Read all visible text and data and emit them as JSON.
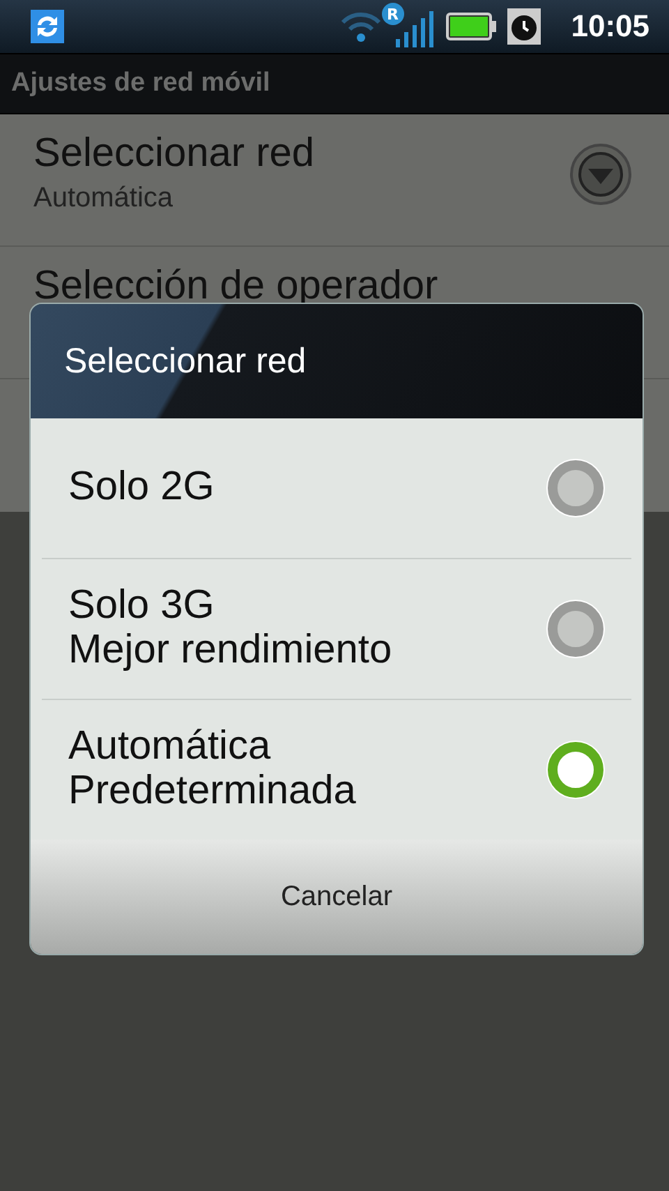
{
  "status_bar": {
    "time": "10:05",
    "roaming": "R"
  },
  "title_bar": {
    "title": "Ajustes de red móvil"
  },
  "settings": [
    {
      "title": "Seleccionar red",
      "summary": "Automática",
      "kind": "dropdown"
    },
    {
      "title": "Selección de operador",
      "kind": "plain"
    }
  ],
  "dialog": {
    "title": "Seleccionar red",
    "options": [
      {
        "lines": [
          "Solo 2G"
        ],
        "selected": false
      },
      {
        "lines": [
          "Solo 3G",
          "Mejor rendimiento"
        ],
        "selected": false
      },
      {
        "lines": [
          "Automática",
          "Predeterminada"
        ],
        "selected": true
      }
    ],
    "button": "Cancelar"
  }
}
